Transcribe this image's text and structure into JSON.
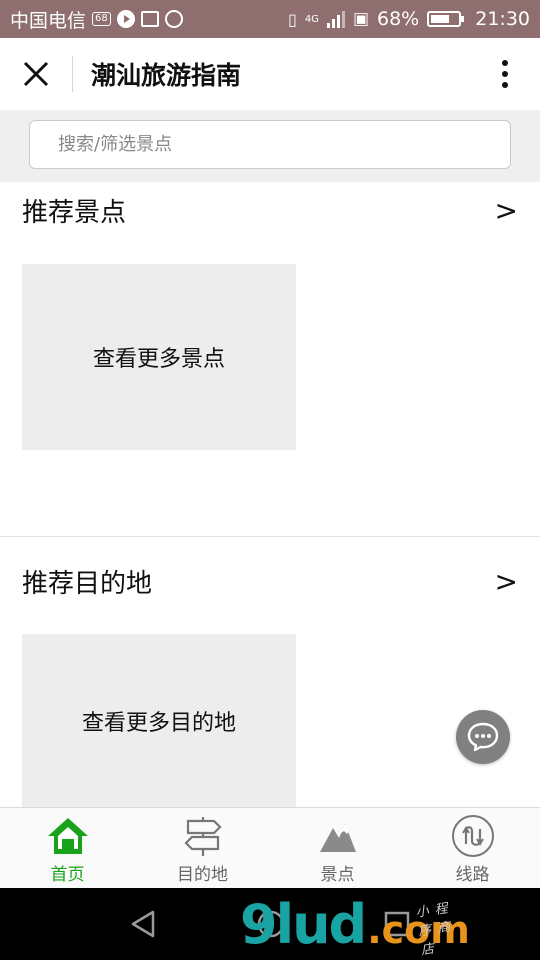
{
  "status_bar": {
    "carrier": "中国电信",
    "badge": "68",
    "network": "4G",
    "battery_percent": "68%",
    "battery_level": 0.68,
    "time": "21:30"
  },
  "header": {
    "title": "潮汕旅游指南"
  },
  "search": {
    "placeholder": "搜索/筛选景点"
  },
  "sections": [
    {
      "title": "推荐景点",
      "chevron": ">",
      "card_label": "查看更多景点"
    },
    {
      "title": "推荐目的地",
      "chevron": ">",
      "card_label": "查看更多目的地"
    }
  ],
  "tabs": [
    {
      "label": "首页",
      "icon": "home-icon",
      "active": true
    },
    {
      "label": "目的地",
      "icon": "signpost-icon",
      "active": false
    },
    {
      "label": "景点",
      "icon": "mountain-icon",
      "active": false
    },
    {
      "label": "线路",
      "icon": "route-icon",
      "active": false
    }
  ],
  "watermark": {
    "main": "9lud",
    "domain": ".com",
    "sub": "小程序商店"
  },
  "colors": {
    "active_tab": "#19a31a",
    "status_bar": "#8e6e6e",
    "watermark_main": "#1aa3a3",
    "watermark_domain": "#e8941b"
  }
}
